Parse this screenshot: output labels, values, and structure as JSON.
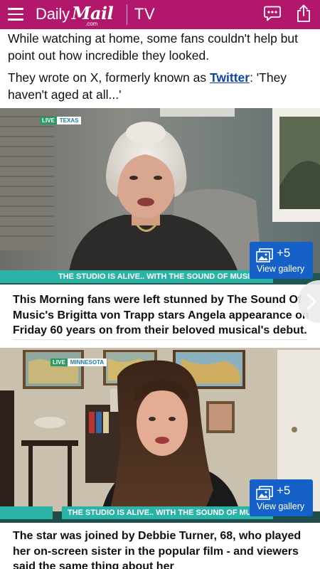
{
  "header": {
    "logo_daily": "Daily",
    "logo_mail": "Mail",
    "logo_com": ".com",
    "section": "TV",
    "background": "#b3176c",
    "icons": [
      "menu-icon",
      "comments-icon",
      "share-icon"
    ]
  },
  "article": {
    "para1": "While watching at home, some fans couldn't help but point out how incredible they looked.",
    "para2_before": "They wrote on X, formerly known as ",
    "para2_link": "Twitter",
    "para2_after": ": 'They haven't aged at all...'"
  },
  "videos": [
    {
      "live": "LIVE",
      "location": "TEXAS",
      "ticker": "THE STUDIO IS ALIVE.. WITH THE SOUND OF MUSIC",
      "gallery_count": "+5",
      "gallery_label": "View gallery",
      "caption": "This Morning fans were left stunned by The Sound Of Music's Brigitta von Trapp stars Angela appearance on Friday 60 years on from their beloved musical's debut."
    },
    {
      "live": "LIVE",
      "location": "MINNESOTA",
      "ticker": "THE STUDIO IS ALIVE.. WITH THE SOUND OF MUSIC",
      "gallery_count": "+5",
      "gallery_label": "View gallery",
      "caption": "The star was joined by Debbie Turner, 68, who played her on-screen sister in the popular film - and viewers said the same thing about her"
    }
  ],
  "colors": {
    "brand": "#b3176c",
    "link": "#0a44a9",
    "gallery_button": "#1561c7",
    "ticker": "#2bb3a7",
    "live_tag": "#2c9a63"
  }
}
